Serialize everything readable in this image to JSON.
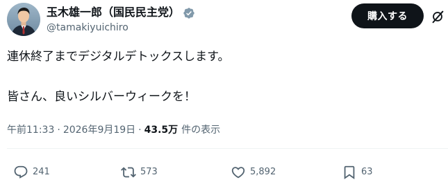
{
  "author": {
    "name": "玉木雄一郎（国民民主党）",
    "handle": "@tamakiyuichiro",
    "verified_icon": "verified-badge-icon"
  },
  "header": {
    "subscribe_label": "購入する",
    "grok_icon": "grok-icon"
  },
  "post": {
    "line1": "連休終了までデジタルデトックスします。",
    "line2": "皆さん、良いシルバーウィークを！"
  },
  "meta": {
    "time": "午前11:33",
    "separator": "·",
    "date": "2026年9月19日",
    "views_count": "43.5万",
    "views_label": "件の表示"
  },
  "actions": {
    "reply_count": "241",
    "repost_count": "573",
    "like_count": "5,892",
    "bookmark_count": "63"
  },
  "colors": {
    "text_primary": "#0f1419",
    "text_secondary": "#536471",
    "verified": "#829aab",
    "button_bg": "#0f1419",
    "divider": "#eff3f4"
  }
}
